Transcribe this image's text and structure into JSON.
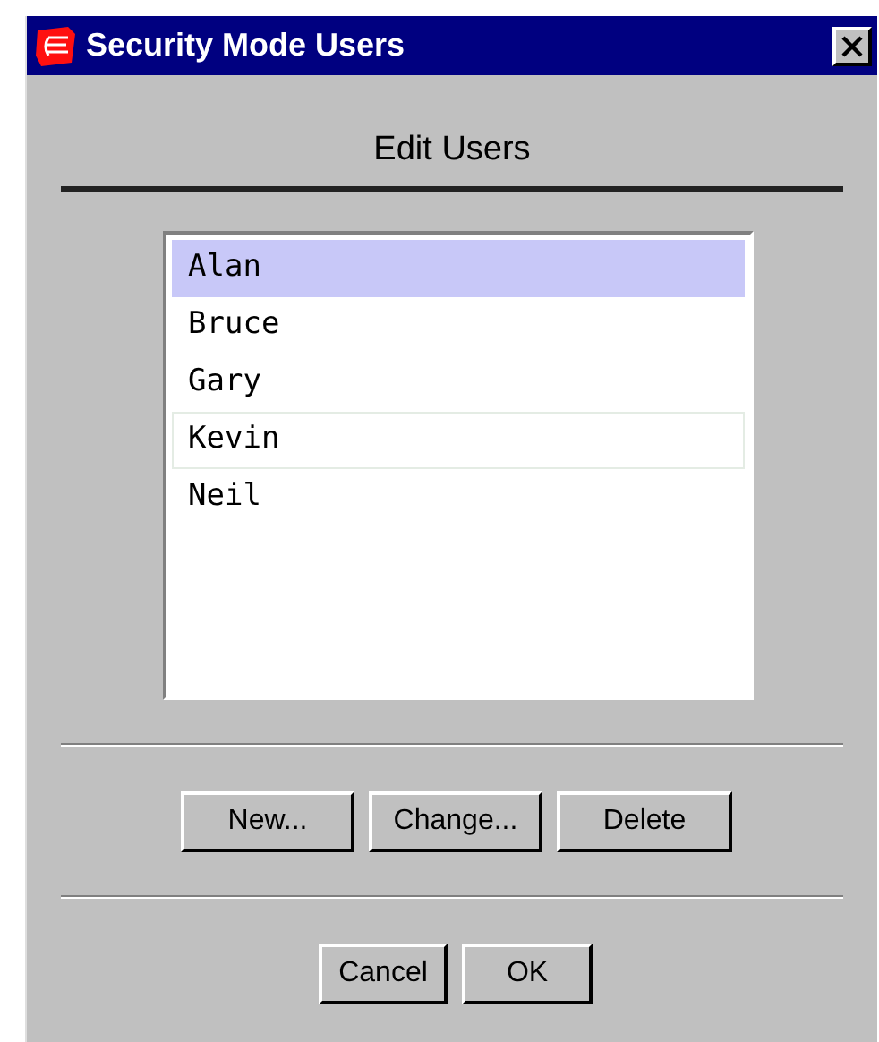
{
  "window": {
    "title": "Security Mode Users"
  },
  "heading": "Edit Users",
  "users": [
    {
      "name": "Alan",
      "selected": true,
      "focused": false
    },
    {
      "name": "Bruce",
      "selected": false,
      "focused": false
    },
    {
      "name": "Gary",
      "selected": false,
      "focused": false
    },
    {
      "name": "Kevin",
      "selected": false,
      "focused": true
    },
    {
      "name": "Neil",
      "selected": false,
      "focused": false
    }
  ],
  "edit_buttons": [
    "New...",
    "Change...",
    "Delete"
  ],
  "dialog_buttons": [
    "Cancel",
    "OK"
  ]
}
